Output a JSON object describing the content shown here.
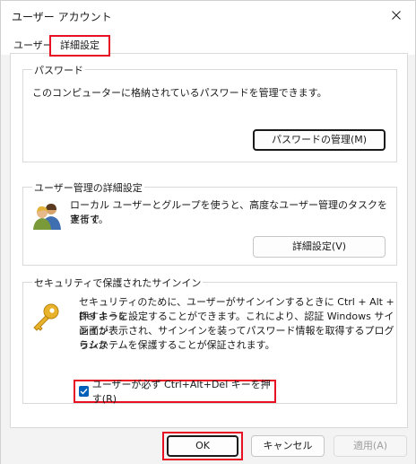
{
  "window": {
    "title": "ユーザー アカウント"
  },
  "tabs": [
    {
      "label": "ユーザー"
    },
    {
      "label": "詳細設定"
    }
  ],
  "password_group": {
    "title": "パスワード",
    "description": "このコンピューターに格納されているパスワードを管理できます。",
    "button_label": "パスワードの管理(M)"
  },
  "user_mgmt_group": {
    "title": "ユーザー管理の詳細設定",
    "description_line1": "ローカル ユーザーとグループを使うと、高度なユーザー管理のタスクを実行で",
    "description_line2": "きます。",
    "button_label": "詳細設定(V)"
  },
  "secure_signin_group": {
    "title": "セキュリティで保護されたサインイン",
    "description_lines": [
      "セキュリティのために、ユーザーがサインインするときに Ctrl + Alt + Del キーを",
      "押すように設定することができます。これにより、認証 Windows サインイン",
      "画面が表示され、サインインを装ってパスワード情報を取得するプログラムか",
      "らシステムを保護することが保証されます。"
    ],
    "checkbox_label": "ユーザーが必ず Ctrl+Alt+Del キーを押す(R)",
    "checkbox_checked": true
  },
  "footer": {
    "ok_label": "OK",
    "cancel_label": "キャンセル",
    "apply_label": "適用(A)"
  },
  "colors": {
    "highlight_red": "#e81123",
    "checkbox_blue": "#005fb8"
  }
}
